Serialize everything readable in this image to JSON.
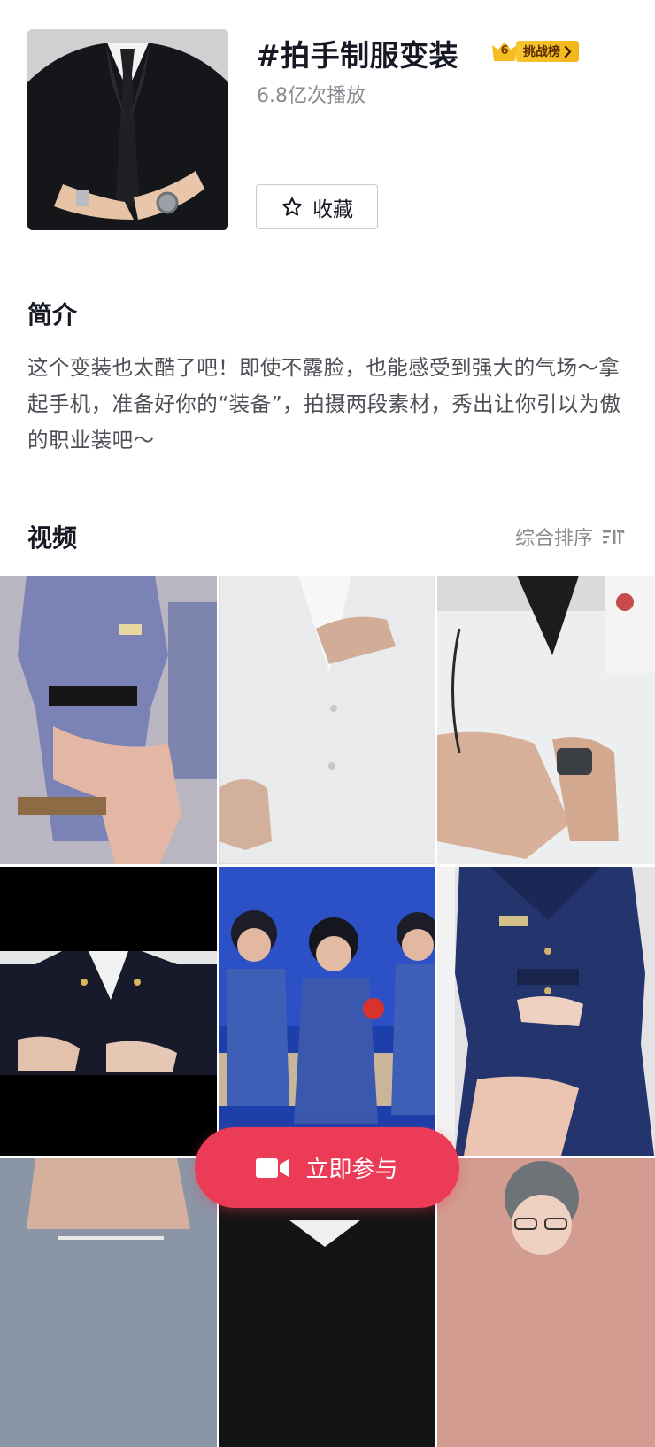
{
  "challenge": {
    "title": "#拍手制服变装",
    "rank_number": "6",
    "rank_label": "挑战榜",
    "plays": "6.8亿次播放",
    "collect_label": "收藏"
  },
  "intro": {
    "heading": "简介",
    "text": "这个变装也太酷了吧！即使不露脸，也能感受到强大的气场～拿起手机，准备好你的“装备”，拍摄两段素材，秀出让你引以为傲的职业装吧～"
  },
  "videos": {
    "heading": "视频",
    "sort_label": "综合排序"
  },
  "join_button": {
    "label": "立即参与"
  },
  "colors": {
    "accent": "#ec3b57",
    "badge": "#f5bd22",
    "text_primary": "#161823",
    "text_secondary": "#8a8b91"
  },
  "icons": [
    "star-icon",
    "sort-icon",
    "crown-icon",
    "chevron-right-icon",
    "video-camera-icon"
  ]
}
